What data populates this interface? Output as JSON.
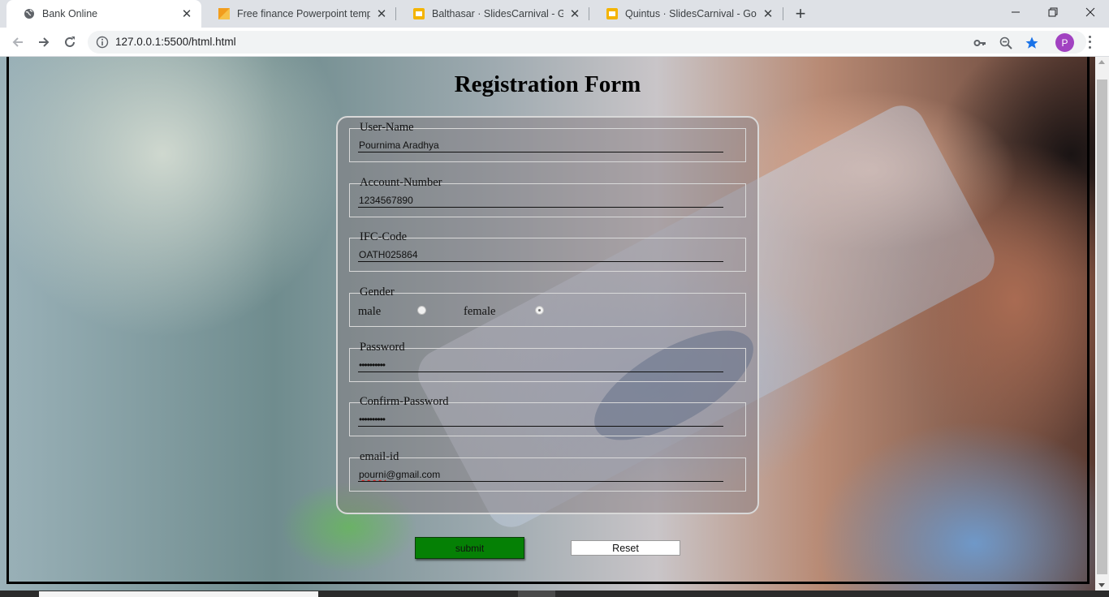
{
  "browser": {
    "tabs": [
      {
        "title": "Bank Online",
        "icon": "globe-icon",
        "active": true
      },
      {
        "title": "Free finance Powerpoint template",
        "icon": "slides-orange-icon",
        "active": false
      },
      {
        "title": "Balthasar · SlidesCarnival - Google",
        "icon": "google-slides-icon",
        "active": false
      },
      {
        "title": "Quintus · SlidesCarnival - Google",
        "icon": "google-slides-icon",
        "active": false
      }
    ],
    "url": "127.0.0.1:5500/html.html",
    "profile_initial": "P",
    "colors": {
      "profile": "#a142c1",
      "bookmark_star": "#1a73e8",
      "tabstrip": "#dee1e6"
    }
  },
  "page": {
    "title": "Registration Form",
    "fields": {
      "username": {
        "legend": "User-Name",
        "value": "Pournima Aradhya"
      },
      "account": {
        "legend": "Account-Number",
        "value": "1234567890"
      },
      "ifc": {
        "legend": "IFC-Code",
        "value": "OATH025864"
      },
      "gender": {
        "legend": "Gender",
        "options": [
          "male",
          "female"
        ],
        "selected": "female"
      },
      "password": {
        "legend": "Password",
        "value": "••••••••••"
      },
      "confirm": {
        "legend": "Confirm-Password",
        "value": "••••••••••"
      },
      "email": {
        "legend": "email-id",
        "value_misspelled": "pourni",
        "value_rest": "@gmail.com"
      }
    },
    "buttons": {
      "submit": "submit",
      "reset": "Reset"
    },
    "colors": {
      "submit": "#058005",
      "reset": "#ffffff"
    }
  }
}
